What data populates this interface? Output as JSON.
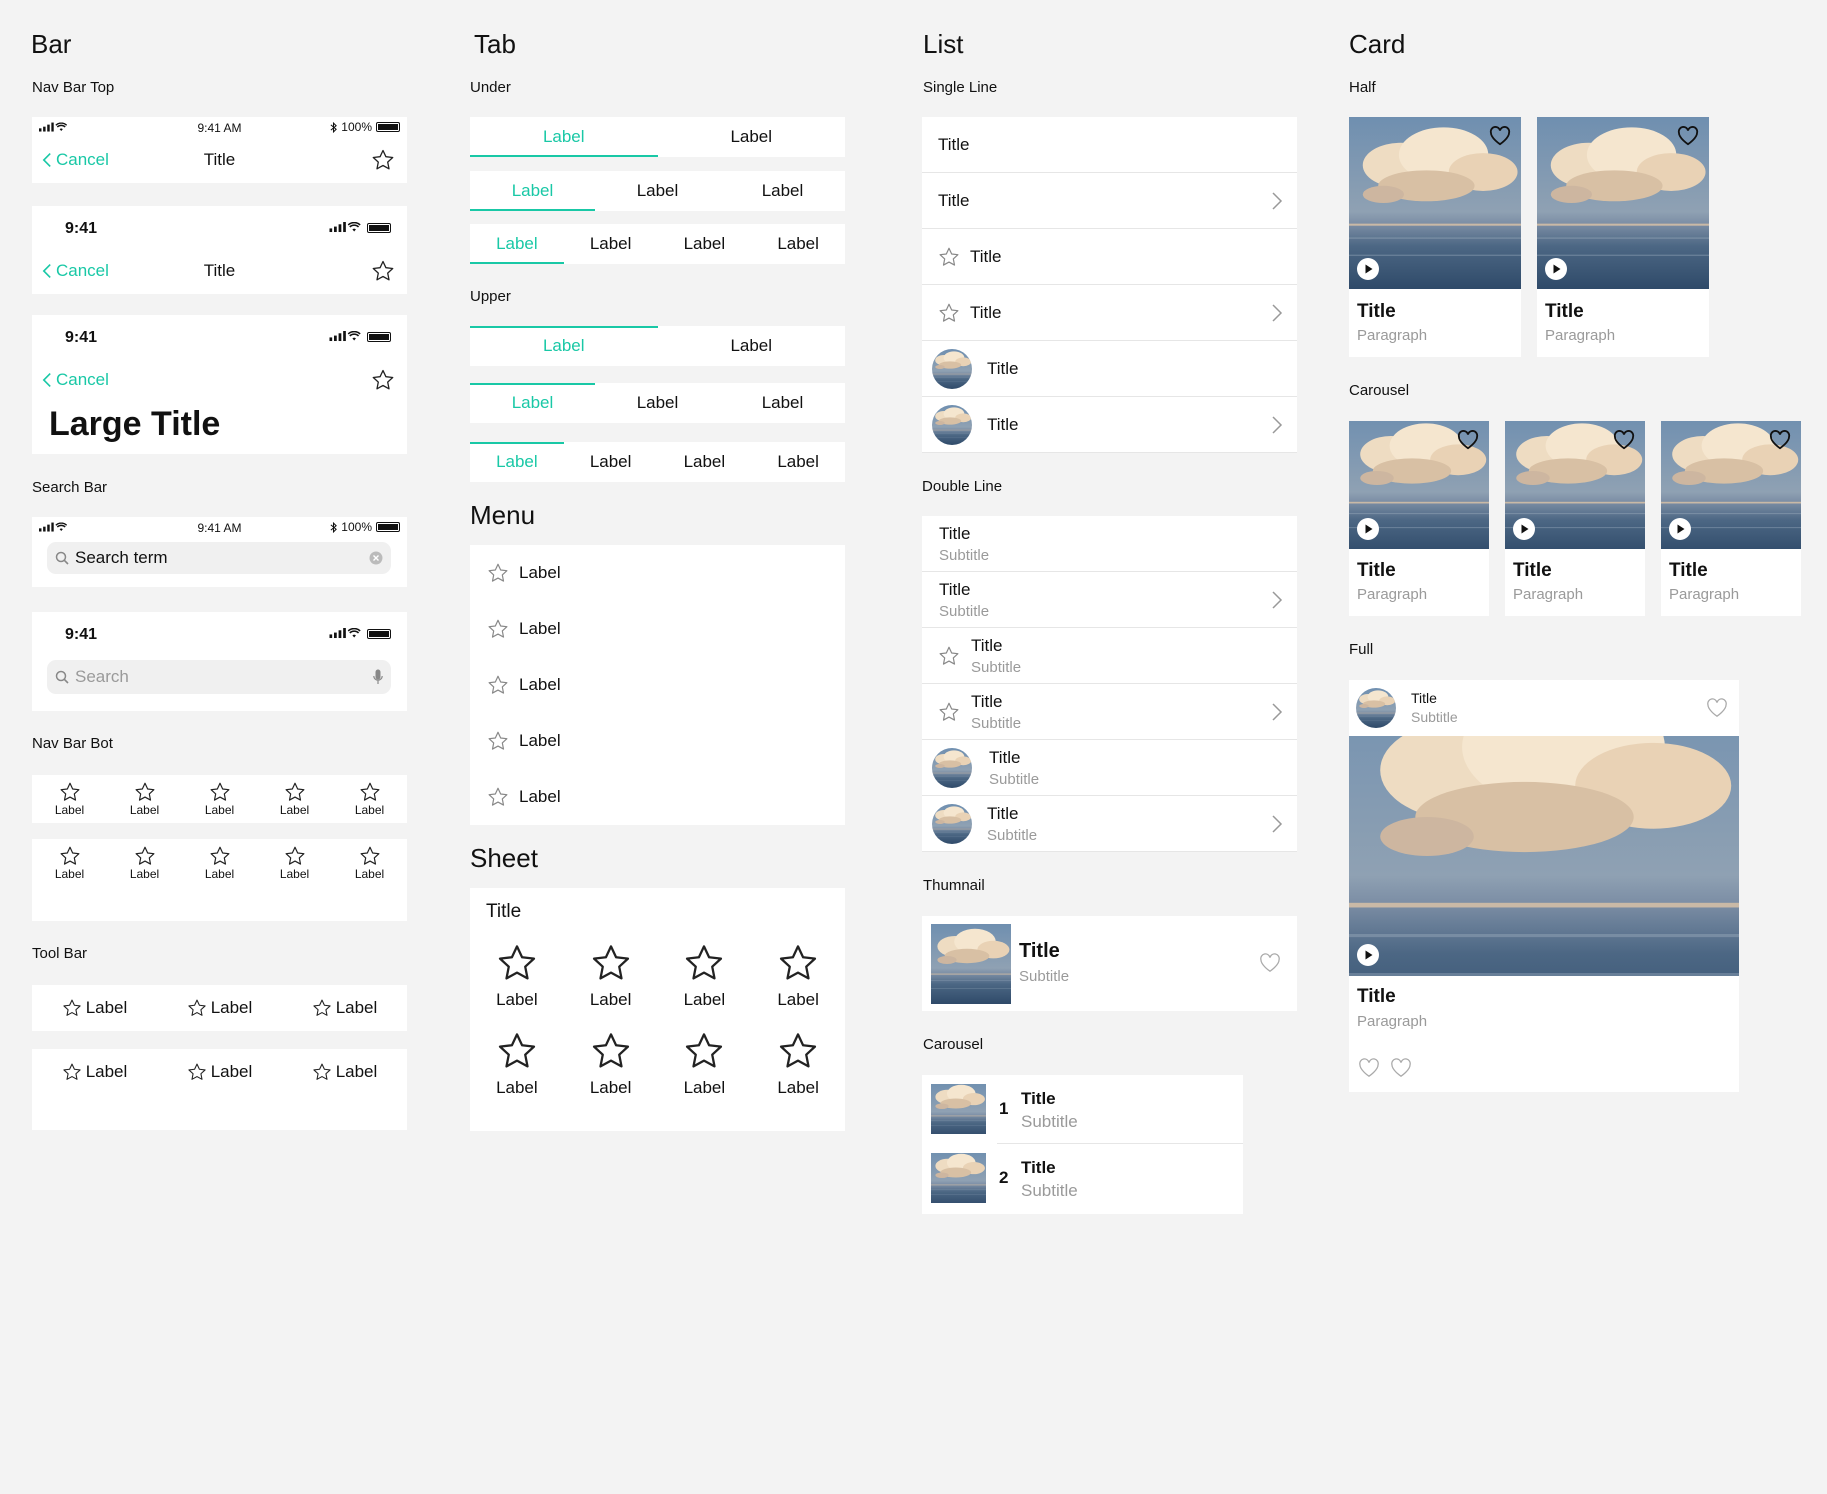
{
  "sections": {
    "bar": "Bar",
    "tab": "Tab",
    "list": "List",
    "card": "Card",
    "menu": "Menu",
    "sheet": "Sheet"
  },
  "bar": {
    "nav_bar_top_label": "Nav Bar Top",
    "status_time_short": "9:41 AM",
    "status_time_big": "9:41",
    "battery_pct": "100%",
    "cancel": "Cancel",
    "title": "Title",
    "large_title": "Large Title",
    "search_bar_label": "Search Bar",
    "search_term": "Search term",
    "search_placeholder": "Search",
    "nav_bar_bot_label": "Nav Bar Bot",
    "bot_items": [
      "Label",
      "Label",
      "Label",
      "Label",
      "Label"
    ],
    "tool_bar_label": "Tool Bar",
    "tool_items": [
      "Label",
      "Label",
      "Label"
    ]
  },
  "tab": {
    "under_label": "Under",
    "upper_label": "Upper",
    "two": [
      "Label",
      "Label"
    ],
    "three": [
      "Label",
      "Label",
      "Label"
    ],
    "four": [
      "Label",
      "Label",
      "Label",
      "Label"
    ]
  },
  "menu": {
    "items": [
      "Label",
      "Label",
      "Label",
      "Label",
      "Label"
    ]
  },
  "sheet": {
    "title": "Sheet",
    "sheet_title": "Title",
    "items": [
      "Label",
      "Label",
      "Label",
      "Label",
      "Label",
      "Label",
      "Label",
      "Label"
    ]
  },
  "list": {
    "single_line_label": "Single Line",
    "single_items": [
      "Title",
      "Title",
      "Title",
      "Title",
      "Title",
      "Title"
    ],
    "double_line_label": "Double Line",
    "double_items": [
      {
        "title": "Title",
        "subtitle": "Subtitle"
      },
      {
        "title": "Title",
        "subtitle": "Subtitle"
      },
      {
        "title": "Title",
        "subtitle": "Subtitle"
      },
      {
        "title": "Title",
        "subtitle": "Subtitle"
      },
      {
        "title": "Title",
        "subtitle": "Subtitle"
      },
      {
        "title": "Title",
        "subtitle": "Subtitle"
      }
    ],
    "thumbnail_label": "Thumnail",
    "thumbnail_item": {
      "title": "Title",
      "subtitle": "Subtitle"
    },
    "carousel_label": "Carousel",
    "carousel_items": [
      {
        "num": "1",
        "title": "Title",
        "subtitle": "Subtitle"
      },
      {
        "num": "2",
        "title": "Title",
        "subtitle": "Subtitle"
      }
    ]
  },
  "card": {
    "half_label": "Half",
    "half_items": [
      {
        "title": "Title",
        "paragraph": "Paragraph"
      },
      {
        "title": "Title",
        "paragraph": "Paragraph"
      }
    ],
    "carousel_label": "Carousel",
    "carousel_items": [
      {
        "title": "Title",
        "paragraph": "Paragraph"
      },
      {
        "title": "Title",
        "paragraph": "Paragraph"
      },
      {
        "title": "Title",
        "paragraph": "Paragraph"
      }
    ],
    "full_label": "Full",
    "full": {
      "header_title": "Title",
      "header_subtitle": "Subtitle",
      "title": "Title",
      "paragraph": "Paragraph"
    }
  },
  "colors": {
    "accent": "#19c8a6",
    "background": "#f3f3f3",
    "panel": "#ffffff"
  }
}
